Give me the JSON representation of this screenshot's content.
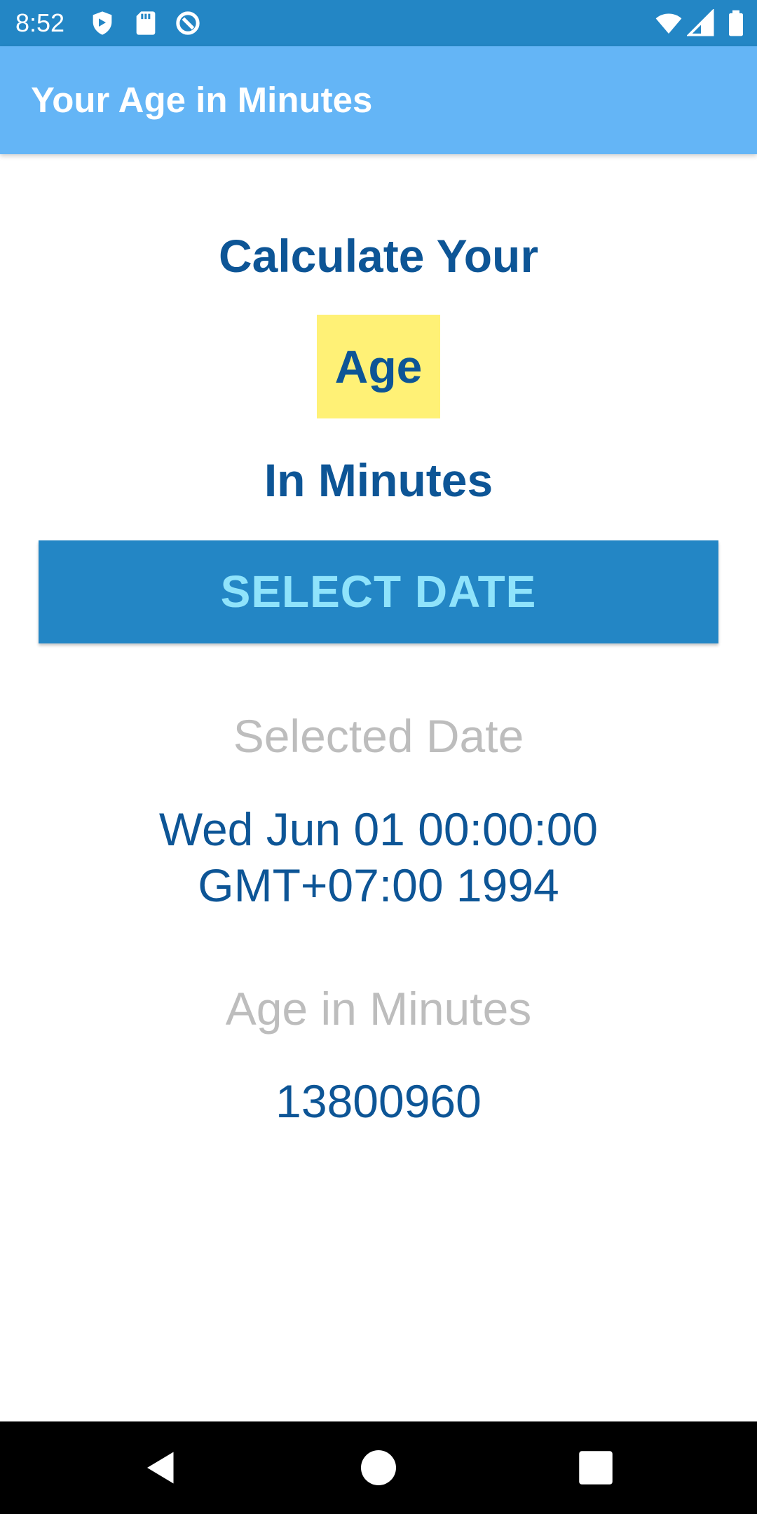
{
  "status_bar": {
    "time": "8:52",
    "icons": [
      "shield-icon",
      "sd-card-icon",
      "sync-icon",
      "wifi-icon",
      "signal-icon",
      "battery-icon"
    ],
    "background": "#2386C5"
  },
  "app_bar": {
    "title": "Your Age in Minutes",
    "background": "#64B5F6"
  },
  "main": {
    "heading_line1": "Calculate Your",
    "heading_highlight": "Age",
    "heading_line3": "In Minutes",
    "select_button_label": "SELECT DATE",
    "selected_date_label": "Selected Date",
    "selected_date_value": "Wed Jun 01 00:00:00 GMT+07:00 1994",
    "age_minutes_label": "Age in Minutes",
    "age_minutes_value": "13800960"
  },
  "colors": {
    "accent": "#2386C5",
    "heading_text": "#0D5596",
    "highlight": "#FFF176",
    "button_text": "#8FE3FB",
    "muted_label": "#BDBDBD"
  },
  "nav_bar": {
    "buttons": [
      "back-icon",
      "home-icon",
      "recents-icon"
    ]
  }
}
